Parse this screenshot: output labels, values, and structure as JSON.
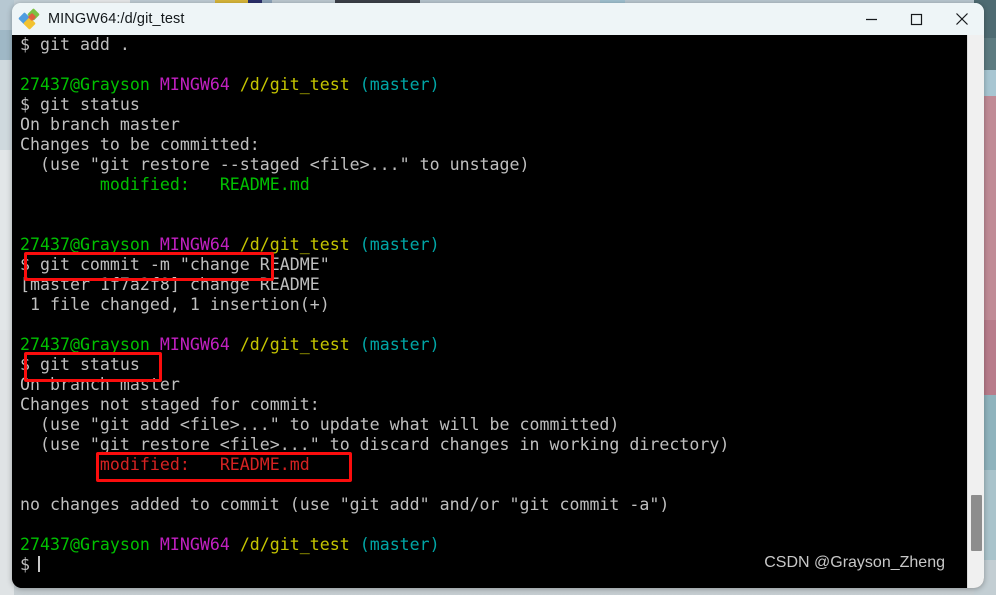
{
  "window": {
    "title": "MINGW64:/d/git_test",
    "app_icon": "mingw-diamond-icon",
    "controls": {
      "minimize": "minimize-icon",
      "maximize": "maximize-icon",
      "close": "close-icon"
    }
  },
  "terminal": {
    "prompt_user_host": "27437@Grayson",
    "prompt_shell": "MINGW64",
    "prompt_path": "/d/git_test",
    "prompt_branch": "(master)",
    "prompt_symbol": "$",
    "colors": {
      "background": "#000000",
      "foreground": "#bfbfbf",
      "green": "#00c100",
      "purple": "#c020c0",
      "yellow": "#c5c500",
      "cyan": "#00a5a5",
      "red": "#d62222",
      "annotation": "#fb0d0d"
    },
    "lines": {
      "l01_cmd": "$ git add .",
      "l02_blank": "",
      "l03_prompt": true,
      "l04_cmd": "$ git status",
      "l05": "On branch master",
      "l06": "Changes to be committed:",
      "l07": "  (use \"git restore --staged <file>...\" to unstage)",
      "l08_label": "        modified:   ",
      "l08_file": "README.md",
      "l09_blank": "",
      "l10_blank": "",
      "l11_prompt": true,
      "l12_cmd": "$ git commit -m \"change README\"",
      "l13": "[master 1f7a2f8] change README",
      "l14": " 1 file changed, 1 insertion(+)",
      "l15_blank": "",
      "l16_prompt": true,
      "l17_cmd": "$ git status",
      "l18": "On branch master",
      "l19": "Changes not staged for commit:",
      "l20": "  (use \"git add <file>...\" to update what will be committed)",
      "l21": "  (use \"git restore <file>...\" to discard changes in working directory)",
      "l22_label": "        modified:   ",
      "l22_file": "README.md",
      "l23_blank": "",
      "l24": "no changes added to commit (use \"git add\" and/or \"git commit -a\")",
      "l25_blank": "",
      "l26_prompt": true,
      "l27_cmd": "$"
    }
  },
  "annotations": [
    {
      "name": "highlight-commit-command",
      "label": "git commit -m \"change README\""
    },
    {
      "name": "highlight-status-command",
      "label": "git status"
    },
    {
      "name": "highlight-modified-readme",
      "label": "modified:   README.md"
    }
  ],
  "watermark": "CSDN @Grayson_Zheng"
}
